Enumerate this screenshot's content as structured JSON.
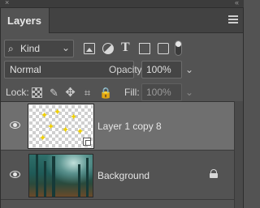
{
  "window": {
    "close_glyph": "×",
    "collapse_glyph": "«"
  },
  "panel": {
    "tab_label": "Layers",
    "menu_icon": "hamburger-menu-icon"
  },
  "filter": {
    "search_glyph": "⌕",
    "kind_label": "Kind",
    "arrow_glyph": "⌄",
    "filter_icons": [
      "image-filter-icon",
      "adjustment-filter-icon",
      "type-filter-icon",
      "shape-filter-icon",
      "smart-object-filter-icon"
    ],
    "type_glyph": "T"
  },
  "blend": {
    "mode": "Normal",
    "opacity_label": "Opacity:",
    "opacity_value": "100%",
    "arrow_glyph": "⌄"
  },
  "lock": {
    "label": "Lock:",
    "brush_glyph": "✎",
    "move_glyph": "✥",
    "artboard_glyph": "⌗",
    "lock_all_glyph": "🔒",
    "fill_label": "Fill:",
    "fill_value": "100%",
    "arrow_glyph": "⌄"
  },
  "layers": [
    {
      "name": "Layer 1 copy 8",
      "selected": true,
      "thumbnail": "butterflies-on-transparent",
      "smart_object_badge": true
    },
    {
      "name": "Background",
      "selected": false,
      "thumbnail": "forest",
      "locked": true
    }
  ],
  "colors": {
    "panel_bg": "#535353",
    "selected_row": "#6f6f6f",
    "butterfly": "#f0d000"
  }
}
